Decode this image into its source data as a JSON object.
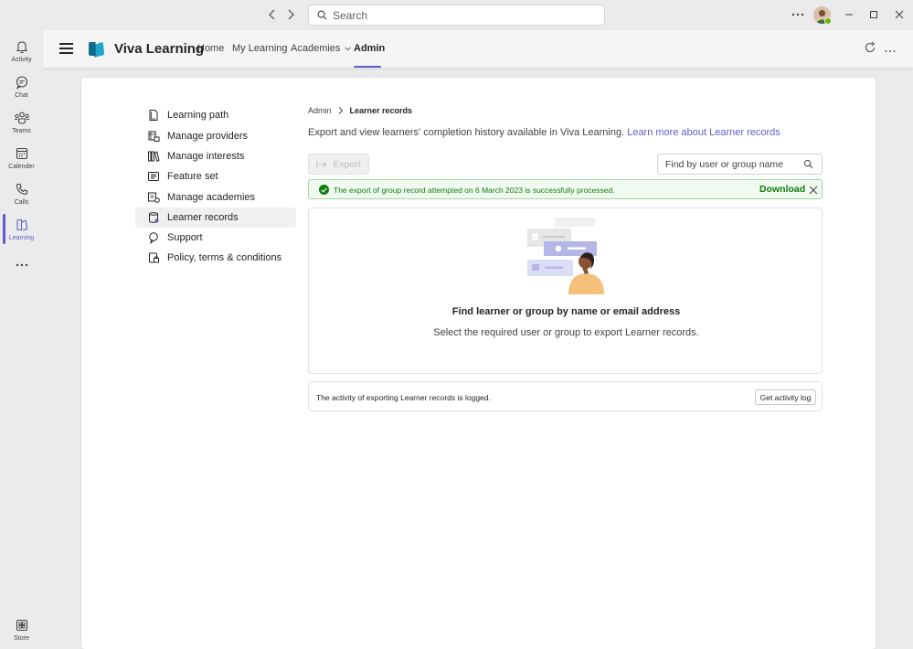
{
  "titlebar": {
    "search_placeholder": "Search"
  },
  "rail": {
    "items": [
      {
        "label": "Activity",
        "icon": "bell-icon"
      },
      {
        "label": "Chat",
        "icon": "chat-icon"
      },
      {
        "label": "Teams",
        "icon": "teams-icon"
      },
      {
        "label": "Calender",
        "icon": "calendar-icon"
      },
      {
        "label": "Calls",
        "icon": "phone-icon"
      },
      {
        "label": "Learning",
        "icon": "learning-icon"
      },
      {
        "label": "Store",
        "icon": "store-icon"
      }
    ],
    "active": "Learning"
  },
  "app": {
    "title": "Viva Learning",
    "tabs": [
      "Home",
      "My Learning",
      "Academies",
      "Admin"
    ],
    "active_tab": "Admin"
  },
  "menu": {
    "items": [
      {
        "label": "Learning path",
        "icon": "document-icon"
      },
      {
        "label": "Manage providers",
        "icon": "providers-icon"
      },
      {
        "label": "Manage interests",
        "icon": "library-icon"
      },
      {
        "label": "Feature set",
        "icon": "feature-icon"
      },
      {
        "label": "Manage academies",
        "icon": "academies-icon"
      },
      {
        "label": "Learner records",
        "icon": "records-icon"
      },
      {
        "label": "Support",
        "icon": "support-icon"
      },
      {
        "label": "Policy, terms & conditions",
        "icon": "policy-icon"
      }
    ],
    "selected": "Learner records"
  },
  "breadcrumb": {
    "parent": "Admin",
    "current": "Learner records"
  },
  "description": {
    "text": "Export and view learners' completion history available in Viva Learning.",
    "link": "Learn more about Learner records"
  },
  "toolbar": {
    "export_label": "Export",
    "find_placeholder": "Find by user or group name"
  },
  "banner": {
    "message": "The export of group record attempted on 6 March 2023 is successfully processed.",
    "action": "Download"
  },
  "empty_state": {
    "title": "Find learner or group by name or email address",
    "subtitle": "Select the required user or group to export Learner records."
  },
  "log": {
    "text": "The activity of exporting Learner records is logged.",
    "button": "Get activity log"
  },
  "colors": {
    "accent": "#5b5fc7",
    "success": "#107c10",
    "success_bg": "#f1faf1"
  }
}
